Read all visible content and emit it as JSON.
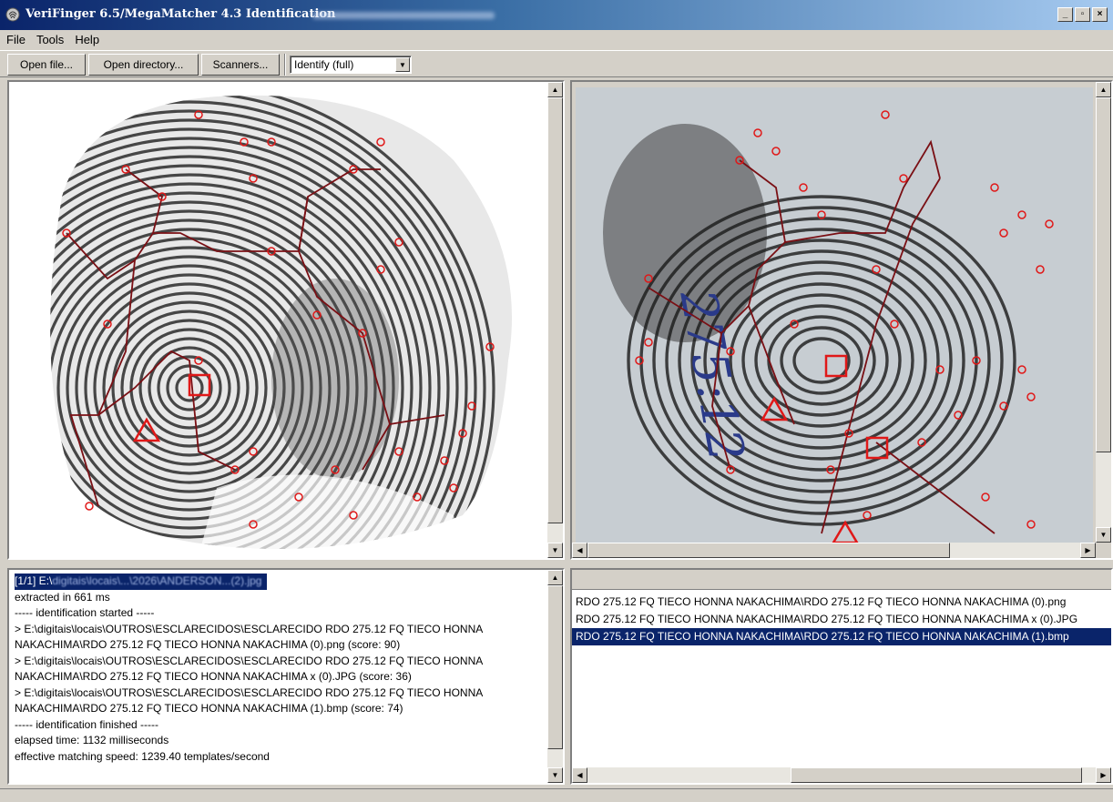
{
  "window": {
    "title": "VeriFinger 6.5/MegaMatcher 4.3 Identification",
    "minimize": "_",
    "maximize": "▫",
    "close": "×"
  },
  "menu": [
    "File",
    "Tools",
    "Help"
  ],
  "toolbar": {
    "open_file": "Open file...",
    "open_directory": "Open directory...",
    "scanners": "Scanners...",
    "mode_value": "Identify (full)"
  },
  "right_image": {
    "handwritten": "275:12"
  },
  "log": [
    {
      "text": "[1/1] E:\\",
      "blur": "digitais\\locais\\...\\2026\\ANDERSON...(2).jpg",
      "selected": true
    },
    {
      "text": "extracted in 661 ms",
      "blur": "",
      "selected": false
    },
    {
      "text": "----- identification started -----",
      "blur": "",
      "selected": false
    },
    {
      "text": "> E:\\digitais\\locais\\OUTROS\\ESCLARECIDOS\\ESCLARECIDO RDO 275.12 FQ TIECO HONNA",
      "blur": "",
      "selected": false
    },
    {
      "text": "NAKACHIMA\\RDO 275.12 FQ TIECO HONNA NAKACHIMA (0).png (score: 90)",
      "blur": "",
      "selected": false
    },
    {
      "text": "> E:\\digitais\\locais\\OUTROS\\ESCLARECIDOS\\ESCLARECIDO RDO 275.12 FQ TIECO HONNA",
      "blur": "",
      "selected": false
    },
    {
      "text": "NAKACHIMA\\RDO 275.12 FQ TIECO HONNA NAKACHIMA x (0).JPG (score: 36)",
      "blur": "",
      "selected": false
    },
    {
      "text": "> E:\\digitais\\locais\\OUTROS\\ESCLARECIDOS\\ESCLARECIDO RDO 275.12 FQ TIECO HONNA",
      "blur": "",
      "selected": false
    },
    {
      "text": "NAKACHIMA\\RDO 275.12 FQ TIECO HONNA NAKACHIMA (1).bmp (score: 74)",
      "blur": "",
      "selected": false
    },
    {
      "text": "----- identification finished -----",
      "blur": "",
      "selected": false
    },
    {
      "text": "elapsed time: 1132 milliseconds",
      "blur": "",
      "selected": false
    },
    {
      "text": "effective matching speed: 1239.40 templates/second",
      "blur": "",
      "selected": false
    }
  ],
  "results": [
    {
      "text": "RDO 275.12 FQ TIECO HONNA NAKACHIMA\\RDO 275.12 FQ TIECO HONNA NAKACHIMA (0).png",
      "selected": false
    },
    {
      "text": "RDO 275.12 FQ TIECO HONNA NAKACHIMA\\RDO 275.12 FQ TIECO HONNA NAKACHIMA x (0).JPG",
      "selected": false
    },
    {
      "text": "RDO 275.12 FQ TIECO HONNA NAKACHIMA\\RDO 275.12 FQ TIECO HONNA NAKACHIMA (1).bmp",
      "selected": true
    }
  ],
  "colors": {
    "minutia": "#e01818",
    "skeleton": "#7a0f14",
    "selection": "#0a246a"
  }
}
